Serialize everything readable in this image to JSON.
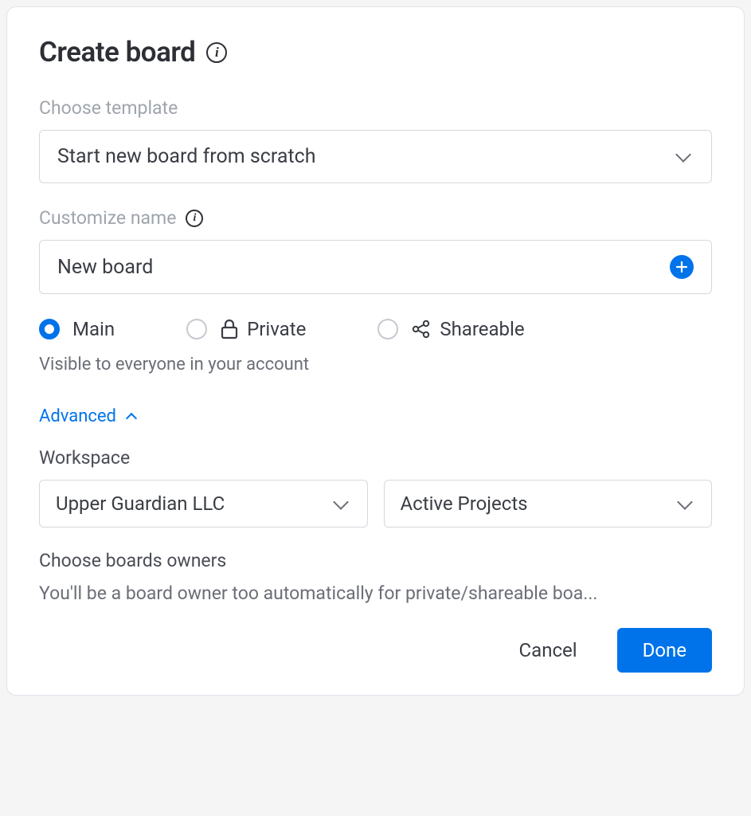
{
  "title": "Create board",
  "template": {
    "label": "Choose template",
    "value": "Start new board from scratch"
  },
  "name": {
    "label": "Customize name",
    "value": "New board"
  },
  "visibility": {
    "options": {
      "main": "Main",
      "private": "Private",
      "shareable": "Shareable"
    },
    "description": "Visible to everyone in your account"
  },
  "advanced": {
    "toggle_label": "Advanced",
    "workspace_label": "Workspace",
    "workspace_value": "Upper Guardian LLC",
    "folder_value": "Active Projects",
    "owners_label": "Choose boards owners",
    "owners_description": "You'll be a board owner too automatically for private/shareable boa..."
  },
  "footer": {
    "cancel": "Cancel",
    "done": "Done"
  }
}
